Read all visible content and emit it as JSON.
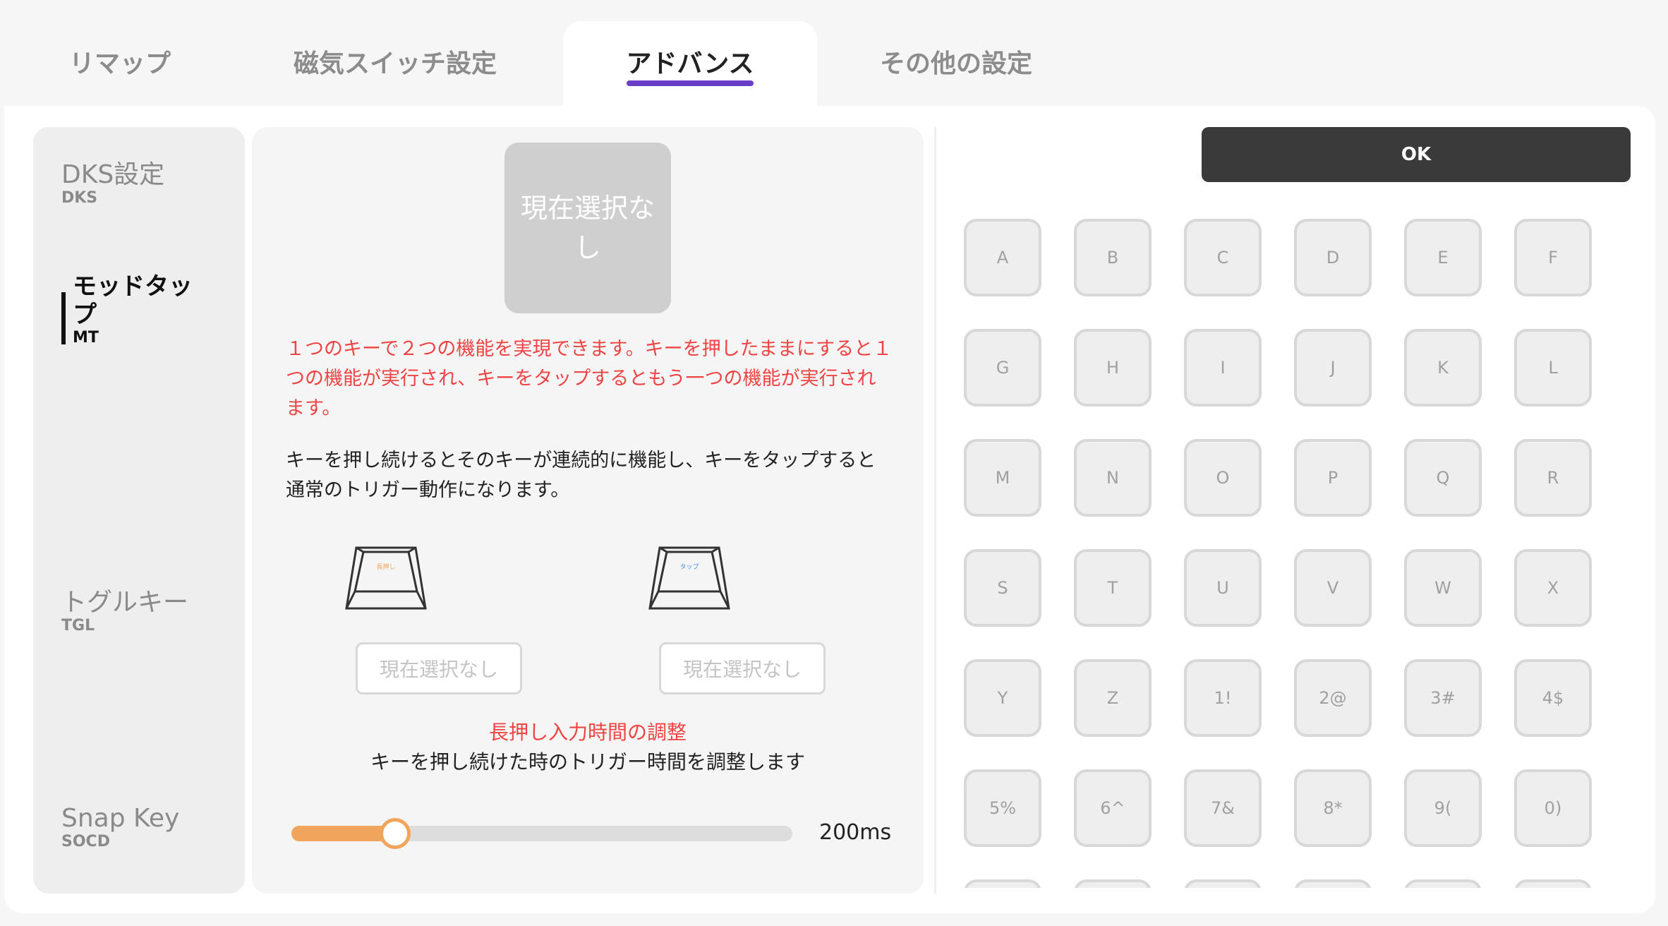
{
  "tabs": [
    {
      "label": "リマップ",
      "active": false
    },
    {
      "label": "磁気スイッチ設定",
      "active": false
    },
    {
      "label": "アドバンス",
      "active": true
    },
    {
      "label": "その他の設定",
      "active": false
    }
  ],
  "accent_color": "#6a3fc8",
  "sidebar": {
    "items": [
      {
        "title": "DKS設定",
        "sub": "DKS",
        "active": false
      },
      {
        "title": "モッドタップ",
        "sub": "MT",
        "active": true
      },
      {
        "title": "トグルキー",
        "sub": "TGL",
        "active": false
      },
      {
        "title": "Snap Key",
        "sub": "SOCD",
        "active": false
      }
    ]
  },
  "center": {
    "current_selection": "現在選択なし",
    "description_red": "１つのキーで２つの機能を実現できます。キーを押したままにすると１つの機能が実行され、キーをタップするともう一つの機能が実行されます。",
    "description_black": "キーを押し続けるとそのキーが連続的に機能し、キーをタップすると通常のトリガー動作になります。",
    "keycap_hold_label": "長押し",
    "keycap_tap_label": "タップ",
    "hold_button": "現在選択なし",
    "tap_button": "現在選択なし",
    "adjust_title": "長押し入力時間の調整",
    "adjust_desc": "キーを押し続けた時のトリガー時間を調整します",
    "slider_value_label": "200ms",
    "slider_fraction": 0.2
  },
  "ok_button": "OK",
  "keys": [
    "A",
    "B",
    "C",
    "D",
    "E",
    "F",
    "G",
    "H",
    "I",
    "J",
    "K",
    "L",
    "M",
    "N",
    "O",
    "P",
    "Q",
    "R",
    "S",
    "T",
    "U",
    "V",
    "W",
    "X",
    "Y",
    "Z",
    "1!",
    "2@",
    "3#",
    "4$",
    "5%",
    "6^",
    "7&",
    "8*",
    "9(",
    "0)",
    "",
    "",
    "",
    "",
    "",
    ""
  ]
}
